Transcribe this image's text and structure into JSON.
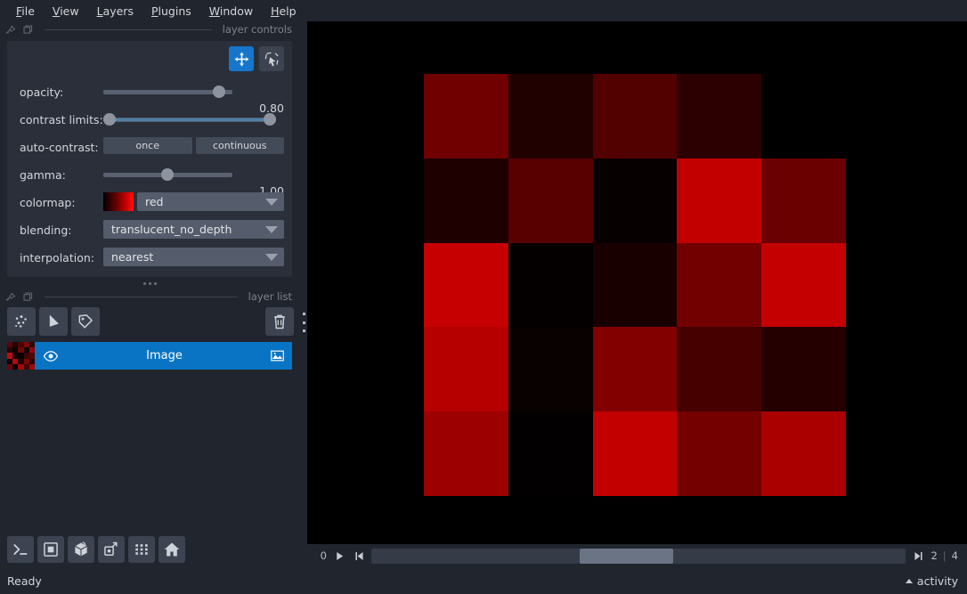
{
  "menubar": {
    "items": [
      {
        "label": "File",
        "accel": "F"
      },
      {
        "label": "View",
        "accel": "V"
      },
      {
        "label": "Layers",
        "accel": "L"
      },
      {
        "label": "Plugins",
        "accel": "P"
      },
      {
        "label": "Window",
        "accel": "W"
      },
      {
        "label": "Help",
        "accel": "H"
      }
    ]
  },
  "layer_controls": {
    "panel_title": "layer controls",
    "tools": [
      {
        "name": "pan-zoom",
        "active": true
      },
      {
        "name": "transform",
        "active": false
      }
    ],
    "opacity": {
      "label": "opacity:",
      "value": "0.80",
      "percent": 78
    },
    "contrast_limits": {
      "label": "contrast limits:",
      "low_percent": 0,
      "high_percent": 100
    },
    "auto_contrast": {
      "label": "auto-contrast:",
      "buttons": [
        "once",
        "continuous"
      ]
    },
    "gamma": {
      "label": "gamma:",
      "value": "1.00",
      "percent": 41
    },
    "colormap": {
      "label": "colormap:",
      "value": "red"
    },
    "blending": {
      "label": "blending:",
      "value": "translucent_no_depth"
    },
    "interpolation": {
      "label": "interpolation:",
      "value": "nearest"
    }
  },
  "layer_list": {
    "panel_title": "layer list",
    "tools": [
      {
        "name": "new-points-layer"
      },
      {
        "name": "new-shapes-layer"
      },
      {
        "name": "new-labels-layer"
      },
      {
        "name": "delete-layer"
      }
    ],
    "layers": [
      {
        "name": "Image",
        "visible": true,
        "selected": true,
        "type": "image"
      }
    ],
    "thumbnail_cells": [
      "#5a0505",
      "#1f0303",
      "#4a0404",
      "#7d0808",
      "#300404",
      "#2a0303",
      "#0b0101",
      "#6e0707",
      "#110101",
      "#8c0909",
      "#c00b0b",
      "#1a0202",
      "#060000",
      "#3f0404",
      "#560606",
      "#0f0101",
      "#b00a0a",
      "#240303",
      "#7a0808",
      "#2d0303",
      "#6b0707",
      "#080000",
      "#a00909",
      "#440505",
      "#9b0909"
    ]
  },
  "viewer_tools": [
    {
      "name": "console"
    },
    {
      "name": "ndisplay-toggle"
    },
    {
      "name": "cube-3d"
    },
    {
      "name": "roll-dims"
    },
    {
      "name": "transpose-grid"
    },
    {
      "name": "home-reset"
    }
  ],
  "dims_slider": {
    "index_label": "0",
    "current": "2",
    "separator": "|",
    "max": "4",
    "handle_left_percent": 39,
    "handle_width_percent": 17.5
  },
  "status_bar": {
    "status": "Ready",
    "activity_label": "activity"
  },
  "canvas": {
    "background": "#000000",
    "grid": {
      "rows": 5,
      "cols": 5,
      "cells": [
        "#700000",
        "#210000",
        "#530000",
        "#2c0000",
        "#000000",
        "#1f0000",
        "#580000",
        "#070000",
        "#c30000",
        "#6a0000",
        "#c60000",
        "#040000",
        "#190000",
        "#730000",
        "#c50000",
        "#b60000",
        "#090000",
        "#830000",
        "#470000",
        "#240000",
        "#9c0000",
        "#020000",
        "#c30000",
        "#740000",
        "#ab0000"
      ]
    }
  },
  "colors": {
    "accent": "#1776cb",
    "selected_row": "#0a74c4",
    "panel_bg": "#2a2f3a",
    "window_bg": "#21252e",
    "text": "#d4d6db",
    "muted_text": "#7d828c"
  }
}
